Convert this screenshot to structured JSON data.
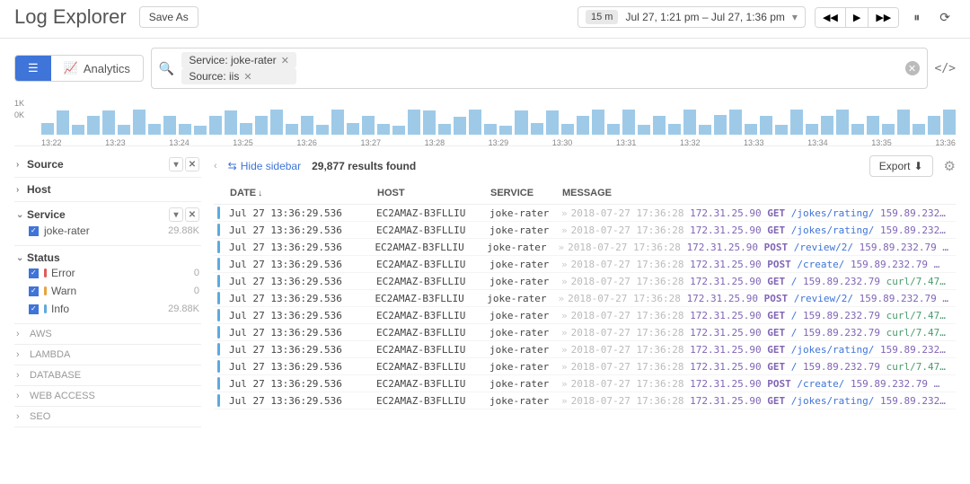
{
  "header": {
    "title": "Log Explorer",
    "save_as": "Save As",
    "time_preset": "15 m",
    "time_range": "Jul 27, 1:21 pm – Jul 27, 1:36 pm"
  },
  "toolbar": {
    "analytics": "Analytics",
    "filters": [
      {
        "label": "Service: joke-rater"
      },
      {
        "label": "Source: iis"
      }
    ]
  },
  "chart_data": {
    "type": "bar",
    "ylabel": "",
    "yticks": [
      "1K",
      "0K"
    ],
    "ylim": [
      0,
      1000
    ],
    "categories": [
      "13:22",
      "13:23",
      "13:24",
      "13:25",
      "13:26",
      "13:27",
      "13:28",
      "13:29",
      "13:30",
      "13:31",
      "13:32",
      "13:33",
      "13:34",
      "13:35",
      "13:36"
    ],
    "values": [
      420,
      900,
      380,
      700,
      910,
      360,
      930,
      400,
      700,
      400,
      340,
      700,
      900,
      420,
      700,
      920,
      400,
      700,
      380,
      930,
      420,
      700,
      400,
      340,
      930,
      900,
      400,
      680,
      920,
      400,
      340,
      900,
      420,
      900,
      400,
      700,
      920,
      400,
      930,
      380,
      700,
      400,
      920,
      380,
      720,
      930,
      400,
      700,
      380,
      930,
      400,
      700,
      920,
      400,
      700,
      390,
      920,
      400,
      700,
      930
    ]
  },
  "sidebar": {
    "facets": {
      "source": {
        "label": "Source"
      },
      "host": {
        "label": "Host"
      },
      "service": {
        "label": "Service",
        "items": [
          {
            "name": "joke-rater",
            "count": "29.88K"
          }
        ]
      },
      "status": {
        "label": "Status",
        "items": [
          {
            "name": "Error",
            "count": "0",
            "color": "#e05b5b"
          },
          {
            "name": "Warn",
            "count": "0",
            "color": "#e8a33d"
          },
          {
            "name": "Info",
            "count": "29.88K",
            "color": "#5fa9dd"
          }
        ]
      }
    },
    "extra": [
      "AWS",
      "LAMBDA",
      "DATABASE",
      "WEB ACCESS",
      "SEO"
    ]
  },
  "results": {
    "hide_sidebar": "Hide sidebar",
    "count_text": "29,877 results found",
    "export": "Export",
    "columns": {
      "date": "DATE",
      "host": "HOST",
      "service": "SERVICE",
      "message": "MESSAGE"
    },
    "rows": [
      {
        "date": "Jul 27 13:36:29.536",
        "host": "EC2AMAZ-B3FLLIU",
        "service": "joke-rater",
        "ts": "2018-07-27 17:36:28",
        "ip": "172.31.25.90",
        "method": "GET",
        "path": "/jokes/rating/",
        "ip2": "159.89.232…"
      },
      {
        "date": "Jul 27 13:36:29.536",
        "host": "EC2AMAZ-B3FLLIU",
        "service": "joke-rater",
        "ts": "2018-07-27 17:36:28",
        "ip": "172.31.25.90",
        "method": "GET",
        "path": "/jokes/rating/",
        "ip2": "159.89.232…"
      },
      {
        "date": "Jul 27 13:36:29.536",
        "host": "EC2AMAZ-B3FLLIU",
        "service": "joke-rater",
        "ts": "2018-07-27 17:36:28",
        "ip": "172.31.25.90",
        "method": "POST",
        "path": "/review/2/",
        "ip2": "159.89.232.79 …"
      },
      {
        "date": "Jul 27 13:36:29.536",
        "host": "EC2AMAZ-B3FLLIU",
        "service": "joke-rater",
        "ts": "2018-07-27 17:36:28",
        "ip": "172.31.25.90",
        "method": "POST",
        "path": "/create/",
        "ip2": "159.89.232.79 …"
      },
      {
        "date": "Jul 27 13:36:29.536",
        "host": "EC2AMAZ-B3FLLIU",
        "service": "joke-rater",
        "ts": "2018-07-27 17:36:28",
        "ip": "172.31.25.90",
        "method": "GET",
        "path": "/",
        "ip2": "159.89.232.79",
        "ua": "curl/7.47…"
      },
      {
        "date": "Jul 27 13:36:29.536",
        "host": "EC2AMAZ-B3FLLIU",
        "service": "joke-rater",
        "ts": "2018-07-27 17:36:28",
        "ip": "172.31.25.90",
        "method": "POST",
        "path": "/review/2/",
        "ip2": "159.89.232.79 …"
      },
      {
        "date": "Jul 27 13:36:29.536",
        "host": "EC2AMAZ-B3FLLIU",
        "service": "joke-rater",
        "ts": "2018-07-27 17:36:28",
        "ip": "172.31.25.90",
        "method": "GET",
        "path": "/",
        "ip2": "159.89.232.79",
        "ua": "curl/7.47…"
      },
      {
        "date": "Jul 27 13:36:29.536",
        "host": "EC2AMAZ-B3FLLIU",
        "service": "joke-rater",
        "ts": "2018-07-27 17:36:28",
        "ip": "172.31.25.90",
        "method": "GET",
        "path": "/",
        "ip2": "159.89.232.79",
        "ua": "curl/7.47…"
      },
      {
        "date": "Jul 27 13:36:29.536",
        "host": "EC2AMAZ-B3FLLIU",
        "service": "joke-rater",
        "ts": "2018-07-27 17:36:28",
        "ip": "172.31.25.90",
        "method": "GET",
        "path": "/jokes/rating/",
        "ip2": "159.89.232…"
      },
      {
        "date": "Jul 27 13:36:29.536",
        "host": "EC2AMAZ-B3FLLIU",
        "service": "joke-rater",
        "ts": "2018-07-27 17:36:28",
        "ip": "172.31.25.90",
        "method": "GET",
        "path": "/",
        "ip2": "159.89.232.79",
        "ua": "curl/7.47…"
      },
      {
        "date": "Jul 27 13:36:29.536",
        "host": "EC2AMAZ-B3FLLIU",
        "service": "joke-rater",
        "ts": "2018-07-27 17:36:28",
        "ip": "172.31.25.90",
        "method": "POST",
        "path": "/create/",
        "ip2": "159.89.232.79 …"
      },
      {
        "date": "Jul 27 13:36:29.536",
        "host": "EC2AMAZ-B3FLLIU",
        "service": "joke-rater",
        "ts": "2018-07-27 17:36:28",
        "ip": "172.31.25.90",
        "method": "GET",
        "path": "/jokes/rating/",
        "ip2": "159.89.232…"
      }
    ]
  }
}
